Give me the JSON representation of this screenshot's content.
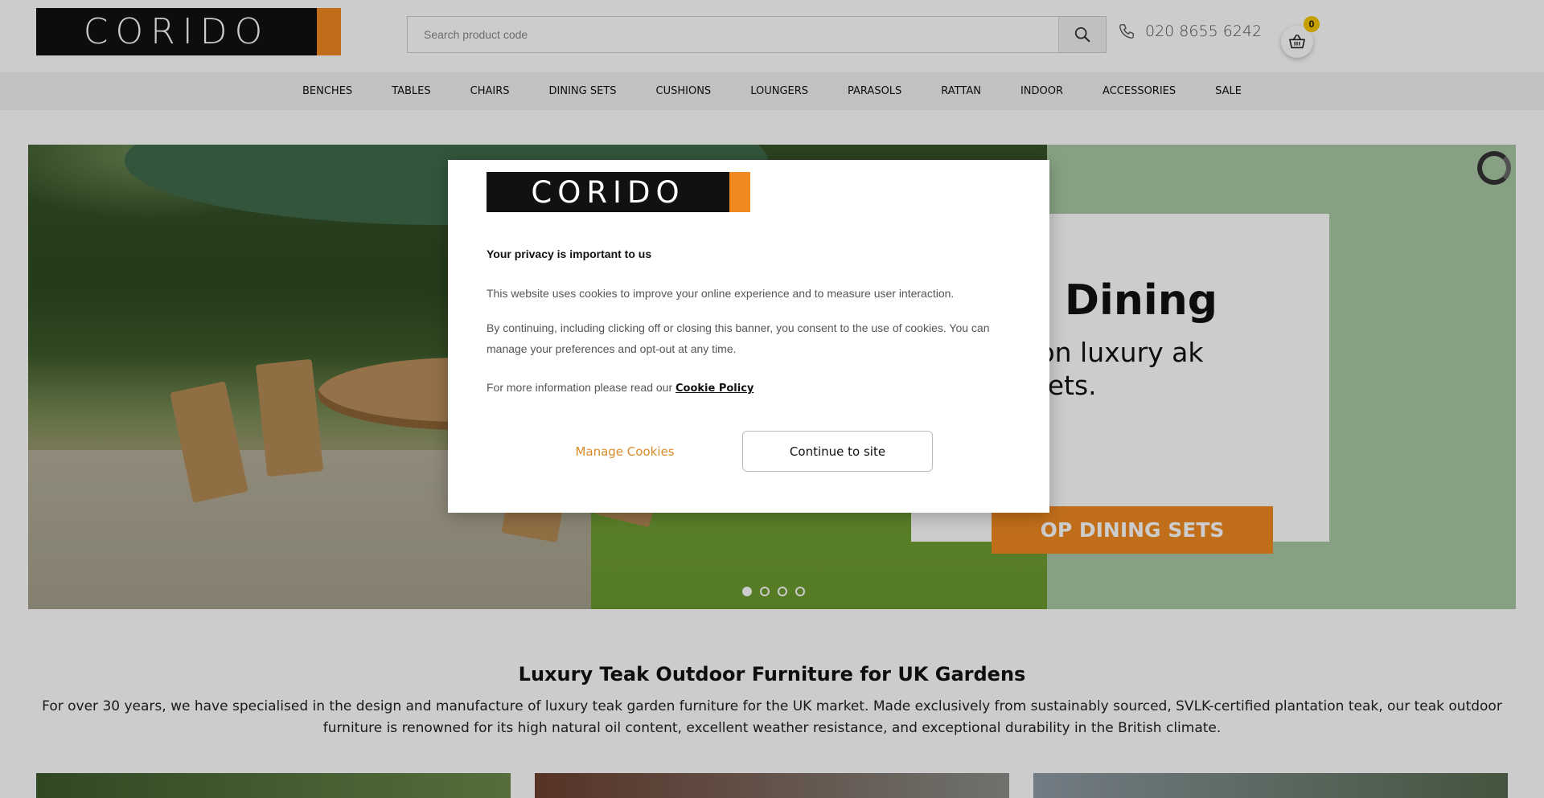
{
  "header": {
    "logo_text": "CORIDO",
    "search_placeholder": "Search product code",
    "phone": "020 8655 6242",
    "basket_count": "0"
  },
  "nav": {
    "items": [
      "BENCHES",
      "TABLES",
      "CHAIRS",
      "DINING SETS",
      "CUSHIONS",
      "LOUNGERS",
      "PARASOLS",
      "RATTAN",
      "INDOOR",
      "ACCESSORIES",
      "SALE"
    ]
  },
  "hero": {
    "promo_title": "esco Dining",
    "promo_text": "avings on luxury ak dining sets.",
    "promo_button": "OP DINING SETS",
    "slide_count": 4,
    "active_slide": 1
  },
  "intro": {
    "title": "Luxury Teak Outdoor Furniture for UK Gardens",
    "text": "For over 30 years, we have specialised in the design and manufacture of luxury teak garden furniture for the UK market. Made exclusively from sustainably sourced, SVLK-certified plantation teak, our teak outdoor furniture is renowned for its high natural oil content, excellent weather resistance, and exceptional durability in the British climate."
  },
  "cookie_modal": {
    "logo_text": "CORIDO",
    "heading": "Your privacy is important to us",
    "paragraph1": "This website uses cookies to improve your online experience and to measure user interaction.",
    "paragraph2": "By continuing, including clicking off or closing this banner, you consent to the use of cookies. You can manage your preferences and opt-out at any time.",
    "paragraph3_prefix": "For more information please read our ",
    "policy_link": "Cookie Policy",
    "manage_label": "Manage Cookies",
    "continue_label": "Continue to site"
  },
  "colors": {
    "brand_orange": "#f08a20",
    "logo_black": "#111111",
    "hero_green": "#a9c9a4",
    "manage_link": "#d98c2a"
  }
}
